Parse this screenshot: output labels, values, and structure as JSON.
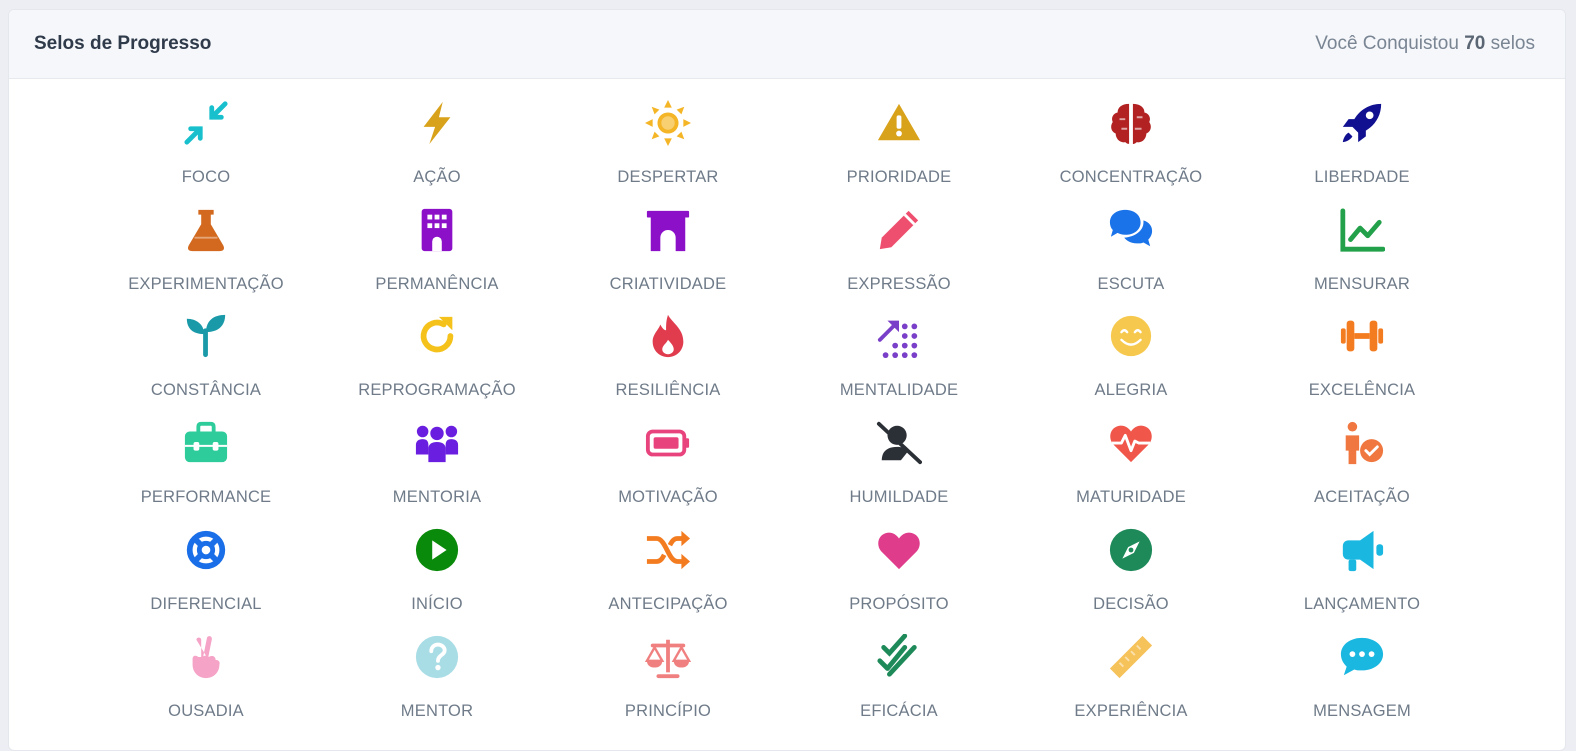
{
  "header": {
    "title": "Selos de Progresso",
    "count_prefix": "Você Conquistou",
    "count_value": "70",
    "count_suffix": "selos"
  },
  "badges": [
    {
      "label": "FOCO",
      "icon": "compress-arrows-icon",
      "color": "#17c0cc"
    },
    {
      "label": "AÇÃO",
      "icon": "bolt-icon",
      "color": "#d9a21b"
    },
    {
      "label": "DESPERTAR",
      "icon": "sun-icon",
      "color": "#f4b526"
    },
    {
      "label": "PRIORIDADE",
      "icon": "warning-icon",
      "color": "#d9a21b"
    },
    {
      "label": "CONCENTRAÇÃO",
      "icon": "brain-icon",
      "color": "#b22222"
    },
    {
      "label": "LIBERDADE",
      "icon": "rocket-icon",
      "color": "#101090"
    },
    {
      "label": "EXPERIMENTAÇÃO",
      "icon": "flask-icon",
      "color": "#d2691e"
    },
    {
      "label": "PERMANÊNCIA",
      "icon": "building-icon",
      "color": "#8b10c8"
    },
    {
      "label": "CRIATIVIDADE",
      "icon": "archway-icon",
      "color": "#8b10c8"
    },
    {
      "label": "EXPRESSÃO",
      "icon": "pencil-icon",
      "color": "#ef4f6f"
    },
    {
      "label": "ESCUTA",
      "icon": "comments-icon",
      "color": "#1a73e8"
    },
    {
      "label": "MENSURAR",
      "icon": "chart-line-icon",
      "color": "#22a04a"
    },
    {
      "label": "CONSTÂNCIA",
      "icon": "seedling-icon",
      "color": "#1a9aa8"
    },
    {
      "label": "REPROGRAMAÇÃO",
      "icon": "redo-icon",
      "color": "#f4c21b"
    },
    {
      "label": "RESILIÊNCIA",
      "icon": "fire-icon",
      "color": "#e03c4e"
    },
    {
      "label": "MENTALIDADE",
      "icon": "arrow-trend-dots-icon",
      "color": "#7a3fc8"
    },
    {
      "label": "ALEGRIA",
      "icon": "smile-icon",
      "color": "#f6c94e"
    },
    {
      "label": "EXCELÊNCIA",
      "icon": "dumbbell-icon",
      "color": "#f47c20"
    },
    {
      "label": "PERFORMANCE",
      "icon": "toolbox-icon",
      "color": "#2ecc9a"
    },
    {
      "label": "MENTORIA",
      "icon": "people-group-icon",
      "color": "#6a1ee0"
    },
    {
      "label": "MOTIVAÇÃO",
      "icon": "battery-icon",
      "color": "#e8437d"
    },
    {
      "label": "HUMILDADE",
      "icon": "user-slash-icon",
      "color": "#2b2f36"
    },
    {
      "label": "MATURIDADE",
      "icon": "heart-pulse-icon",
      "color": "#f0564a"
    },
    {
      "label": "ACEITAÇÃO",
      "icon": "person-check-icon",
      "color": "#f07840"
    },
    {
      "label": "DIFERENCIAL",
      "icon": "life-ring-icon",
      "color": "#1a6fe8"
    },
    {
      "label": "INÍCIO",
      "icon": "play-circle-icon",
      "color": "#0a8a0a"
    },
    {
      "label": "ANTECIPAÇÃO",
      "icon": "shuffle-icon",
      "color": "#f47c20"
    },
    {
      "label": "PROPÓSITO",
      "icon": "heart-icon",
      "color": "#e03c8c"
    },
    {
      "label": "DECISÃO",
      "icon": "compass-icon",
      "color": "#1e8a5a"
    },
    {
      "label": "LANÇAMENTO",
      "icon": "bullhorn-icon",
      "color": "#1ab8e0"
    },
    {
      "label": "OUSADIA",
      "icon": "peace-hand-icon",
      "color": "#f5a3c7"
    },
    {
      "label": "MENTOR",
      "icon": "question-circle-icon",
      "color": "#a9dde6"
    },
    {
      "label": "PRINCÍPIO",
      "icon": "scale-balance-icon",
      "color": "#f08080"
    },
    {
      "label": "EFICÁCIA",
      "icon": "double-check-icon",
      "color": "#1e8a5a"
    },
    {
      "label": "EXPERIÊNCIA",
      "icon": "ruler-icon",
      "color": "#f6c25a"
    },
    {
      "label": "MENSAGEM",
      "icon": "comment-dots-icon",
      "color": "#1ab8e0"
    }
  ]
}
